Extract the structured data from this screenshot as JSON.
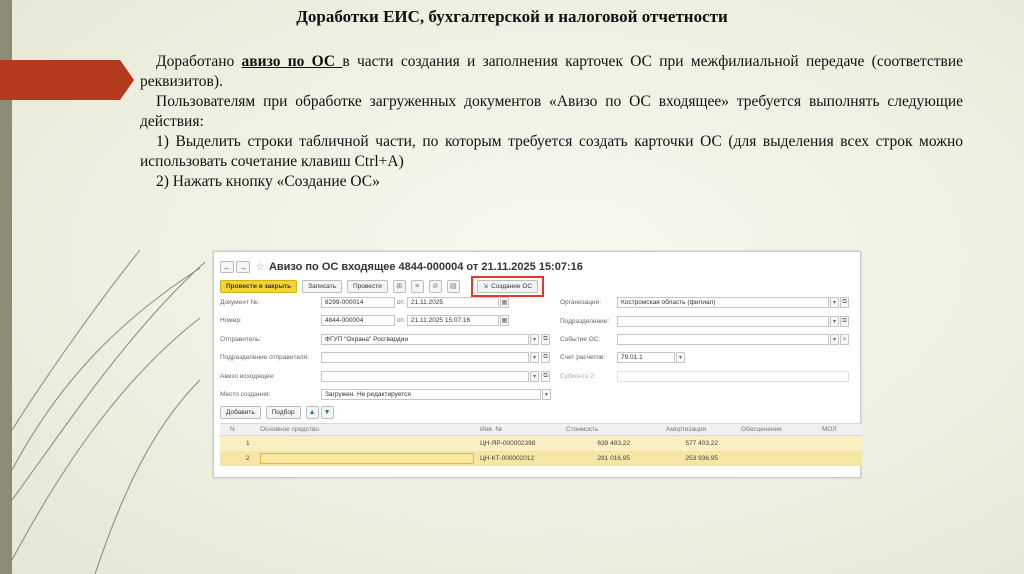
{
  "slide": {
    "title": "Доработки ЕИС, бухгалтерской и налоговой отчетности",
    "p1_lead": "Доработано ",
    "p1_link": "авизо по ОС ",
    "p1_rest": "в части создания и заполнения карточек ОС при межфилиальной передаче (соответствие реквизитов).",
    "p2": "Пользователям при обработке загруженных документов «Авизо по ОС входящее» требуется выполнять следующие действия:",
    "p3": "1) Выделить строки табличной части, по которым требуется создать карточки ОС (для выделения всех строк можно использовать сочетание клавиш Ctrl+A)",
    "p4": "2) Нажать кнопку «Создание ОС»"
  },
  "window": {
    "back": "←",
    "forward": "→",
    "star": "☆",
    "title": "Авизо по ОС входящее 4844-000004 от 21.11.2025 15:07:16",
    "toolbar": {
      "post_close": "Провести и закрыть",
      "save": "Записать",
      "post": "Провести",
      "create_os": "Создание ОС"
    },
    "form": {
      "doc_no_label": "Документ №:",
      "doc_no": "8299-000014",
      "from1": "от:",
      "doc_date": "21.11.2025",
      "number_label": "Номер:",
      "number": "4844-000004",
      "from2": "от:",
      "number_date": "21.11.2025 15:07:16",
      "sender_label": "Отправитель:",
      "sender": "ФГУП \"Охрана\" Росгвардии",
      "sender_dept_label": "Подразделение отправителя:",
      "aviso_out_label": "Авизо исходящее:",
      "place_label": "Место создания:",
      "place": "Загружен. Не редактируется",
      "org_label": "Организация:",
      "org": "Костромская область (филиал)",
      "dept_label": "Подразделение:",
      "event_label": "Событие ОС:",
      "account_label": "Счет расчетов:",
      "account": "79.01.1",
      "subconto_label": "Субконто 2:"
    },
    "table_buttons": {
      "add": "Добавить",
      "select": "Подбор",
      "up": "▲",
      "down": "▼"
    },
    "table": {
      "headers": [
        "N",
        "Основное средство",
        "Инв. №",
        "Стоимость",
        "Амортизация",
        "Обесценение",
        "МОЛ"
      ],
      "rows": [
        {
          "n": "1",
          "asset": "",
          "inv": "ЦН-ЯР-000002398",
          "cost": "639 483,22",
          "amort": "577 403,22"
        },
        {
          "n": "2",
          "asset": "",
          "inv": "ЦН-КТ-000002012",
          "cost": "281 016,95",
          "amort": "253 936,95"
        }
      ]
    }
  }
}
